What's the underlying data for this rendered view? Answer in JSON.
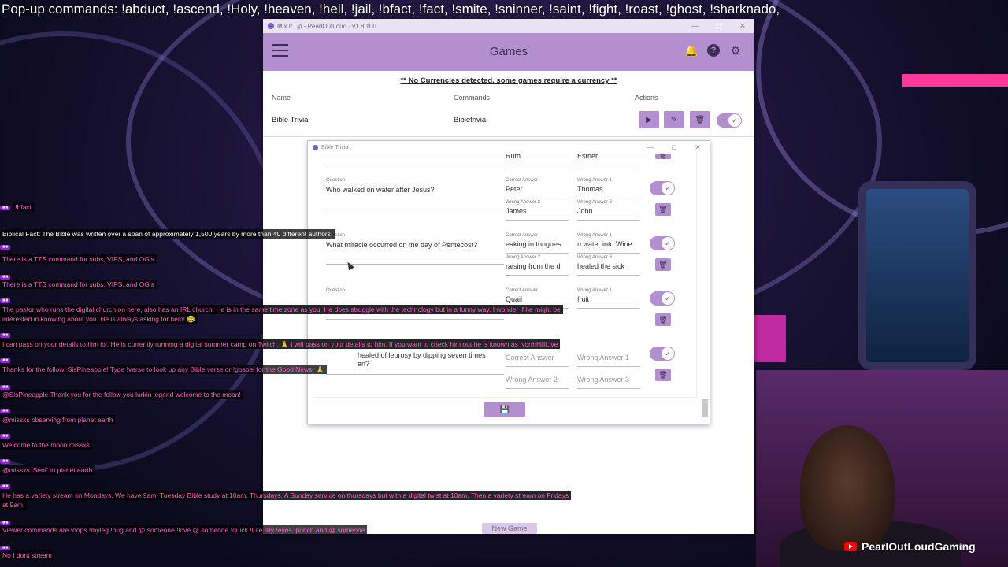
{
  "popup_bar": {
    "text": "Pop-up commands: !abduct, !ascend, !Holy, !heaven, !hell,  !jail, !bfact, !fact, !smite, !sninner, !saint, !fight, !roast, !ghost, !sharknado,"
  },
  "app": {
    "window_title": "Mix It Up - PearlOutLoud - v1.8.100",
    "header_title": "Games",
    "notice": "** No Currencies detected, some games require a currency **",
    "columns": {
      "name": "Name",
      "commands": "Commands",
      "actions": "Actions"
    },
    "games": [
      {
        "name": "Bible Trivia",
        "command": "Bibletrivia"
      }
    ],
    "new_game_label": "New Game",
    "icons": {
      "menu": "hamburger-menu-icon",
      "bell": "bell-icon",
      "help": "help-icon",
      "settings": "gear-icon",
      "play": "play-icon",
      "edit": "edit-icon",
      "delete": "trash-icon",
      "save": "save-icon"
    }
  },
  "trivia_window": {
    "title": "Bible Trivia",
    "labels": {
      "question": "Question",
      "correct": "Correct Answer",
      "wrong1": "Wrong Answer 1",
      "wrong2": "Wrong Answer 2",
      "wrong3": "Wrong Answer 3"
    },
    "partial_top": {
      "a": "Ruth",
      "b": "Esther"
    },
    "questions": [
      {
        "question": "Who walked on water after Jesus?",
        "correct": "Peter",
        "wrong1": "Thomas",
        "wrong2": "James",
        "wrong3": "John"
      },
      {
        "question": "What miracle occurred on the day of Pentecost?",
        "correct": "eaking in tongues",
        "wrong1": "n water into Wine",
        "wrong2": "raising from the d",
        "wrong3": "healed the sick"
      },
      {
        "question": "",
        "correct": "Quail",
        "wrong1": "fruit",
        "wrong2": "",
        "wrong3": ""
      },
      {
        "question": "healed of leprosy by dipping seven times",
        "question_line2": "an?",
        "correct": "",
        "wrong1": "",
        "wrong2": "",
        "wrong3": ""
      }
    ]
  },
  "chat": [
    {
      "name": "",
      "msg": "!bfact",
      "white": false
    },
    {
      "name": "",
      "msg": "Biblical Fact: The Bible was written over a span of approximately 1,500 years by more than 40 different authors.",
      "white": true
    },
    {
      "name": "",
      "msg": "There is a TTS command for subs, VIPS, and OG's",
      "white": false
    },
    {
      "name": "",
      "msg": "There is a TTS command for subs, VIPS, and OG's",
      "white": false
    },
    {
      "name": "",
      "msg": "The pastor who runs the digital church on here, also has an IRL church. He is in the same time zone as you. He does struggle with the technology but in a funny way. I wonder if he might be",
      "white": false
    },
    {
      "name": "",
      "msg": "interested in knowing about you. He is always asking for help! 😂",
      "white": false
    },
    {
      "name": "",
      "msg": "I can pass on your details to him lol. He is currently running a digital summer camp on Twitch. 🙏 I will pass on your details to him. If you want to check him out he is known as NorthHillLive",
      "white": false
    },
    {
      "name": "",
      "msg": "Thanks for the follow, SisPineapple! Type !verse to look up any Bible verse or !gospel for the Good News! 🙏",
      "white": false
    },
    {
      "name": "",
      "msg": "@SisPineapple Thank you for the follow you lurkin legend welcome to the moon!",
      "white": false
    },
    {
      "name": "",
      "msg": "@missxs observing from planet earth",
      "white": false
    },
    {
      "name": "",
      "msg": "Welcome to the moon missxs",
      "white": false
    },
    {
      "name": "",
      "msg": "@missxs 'Sent' to planet earth",
      "white": false
    },
    {
      "name": "",
      "msg": "He has a variety stream on Mondays. We have 9am. Tuesday Bible study at 10am. Thursdays, A Sunday service on thursdays but with a digital twist at 10am. Then a variety stream on Fridays",
      "white": false
    },
    {
      "name": "",
      "msg": "at 9am.",
      "white": false
    },
    {
      "name": "",
      "msg": "Viewer commands are !oops !myleg !hug and @ someone !love @ someone !quick !lute !lily !eyes !punch and @ someone",
      "white": false
    },
    {
      "name": "",
      "msg": "No I dont stream",
      "white": false
    }
  ],
  "streamer": {
    "channel": "PearlOutLoudGaming",
    "icon": "youtube-icon"
  }
}
